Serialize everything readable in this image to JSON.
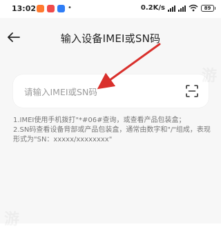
{
  "status_bar": {
    "time": "13:02",
    "app_icons": [
      {
        "name": "app-icon-orange",
        "color": "#ff7a2f"
      },
      {
        "name": "app-icon-red",
        "color": "#f04b4b"
      },
      {
        "name": "app-icon-blue",
        "color": "#2f7df6"
      }
    ],
    "network_speed": "0.2K/s",
    "battery_level": "89"
  },
  "header": {
    "title": "输入设备IMEI或SN码"
  },
  "input": {
    "placeholder": "请输入IMEI或SN码",
    "value": ""
  },
  "notes": [
    "1.IMEI使用手机拨打\"*#06#查询，或查看产品包装盒；",
    "2.SN码查看设备背部或产品包装盒，通常由数字和\"/\"组成，表现形式为\"SN：xxxxx/xxxxxxxx\""
  ],
  "colors": {
    "background": "#f7f7f7",
    "card": "#ffffff",
    "annotation_arrow": "#d9302c"
  },
  "icons": {
    "back": "arrow-left-icon",
    "scan": "scan-icon"
  }
}
